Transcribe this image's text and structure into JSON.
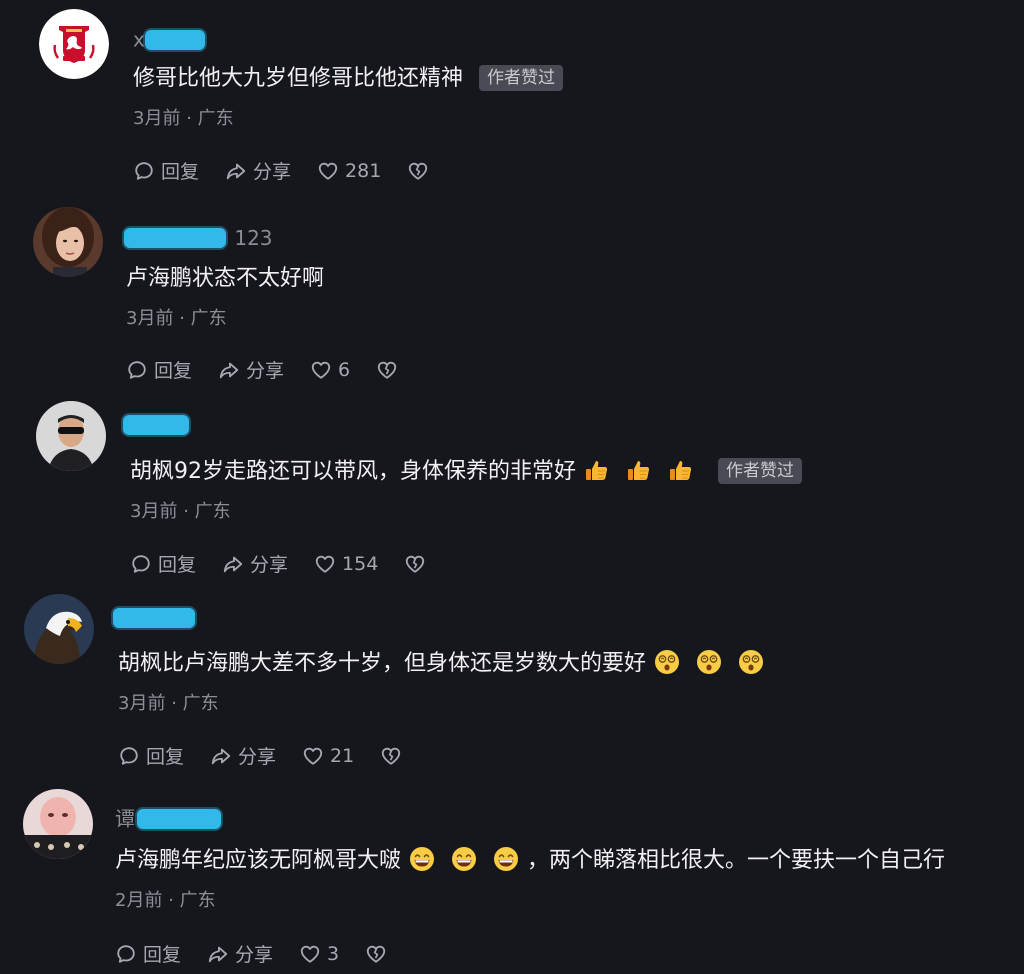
{
  "comments": [
    {
      "username": "x",
      "text": "修哥比他大九岁但修哥比他还精神",
      "badge": "作者赞过",
      "time": "3月前",
      "location": "广东",
      "reply_label": "回复",
      "share_label": "分享",
      "likes": "281"
    },
    {
      "username": "123",
      "text": "卢海鹏状态不太好啊",
      "badge": "",
      "time": "3月前",
      "location": "广东",
      "reply_label": "回复",
      "share_label": "分享",
      "likes": "6"
    },
    {
      "username": "",
      "text": "胡枫92岁走路还可以带风，身体保养的非常好",
      "badge": "作者赞过",
      "time": "3月前",
      "location": "广东",
      "reply_label": "回复",
      "share_label": "分享",
      "likes": "154"
    },
    {
      "username": "",
      "text": "胡枫比卢海鹏大差不多十岁，但身体还是岁数大的要好",
      "badge": "",
      "time": "3月前",
      "location": "广东",
      "reply_label": "回复",
      "share_label": "分享",
      "likes": "21"
    },
    {
      "username": "谭",
      "text": "卢海鹏年纪应该无阿枫哥大啵",
      "text_after": "，两个睇落相比很大。一个要扶一个自己行",
      "badge": "",
      "time": "2月前",
      "location": "广东",
      "reply_label": "回复",
      "share_label": "分享",
      "likes": "3"
    }
  ],
  "separator": "·",
  "colors": {
    "background": "#16161d",
    "redaction": "#31b9e9",
    "badge_bg": "#4a4a54"
  },
  "icons": {
    "reply": "comment-bubble-icon",
    "share": "share-arrow-icon",
    "like": "heart-icon",
    "dislike": "broken-heart-icon",
    "thumbs": "thumbs-up-emoji-icon",
    "dizzy": "dizzy-face-emoji-icon",
    "grin": "grinning-face-emoji-icon"
  }
}
